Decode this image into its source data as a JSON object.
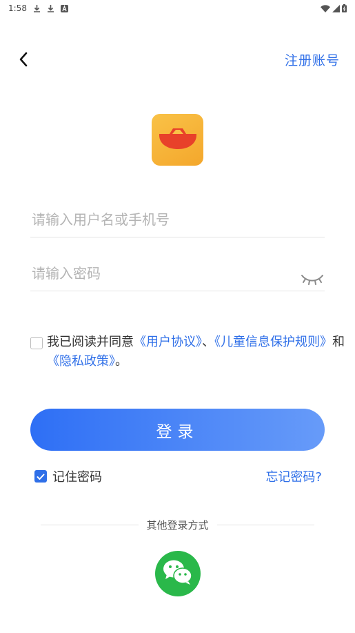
{
  "status_bar": {
    "time": "1:58",
    "icons": [
      "download-icon",
      "download-icon",
      "a-notification-icon",
      "wifi-icon",
      "signal-icon",
      "battery-icon"
    ]
  },
  "nav": {
    "back_icon": "chevron-left-icon",
    "register_label": "注册账号"
  },
  "logo": {
    "icon": "boat-icon",
    "colors": {
      "bg_top": "#f9c247",
      "bg_bottom": "#f4a72c",
      "boat": "#e8412a"
    }
  },
  "form": {
    "username": {
      "value": "",
      "placeholder": "请输入用户名或手机号"
    },
    "password": {
      "value": "",
      "placeholder": "请输入密码",
      "toggle_icon": "eye-closed-icon"
    }
  },
  "agreement": {
    "checked": false,
    "prefix": "我已阅读并同意",
    "user_agreement": "《用户协议》",
    "sep": "、",
    "child_privacy": "《儿童信息保护规则》",
    "and": "和",
    "privacy_policy": "《隐私政策》",
    "end": "。"
  },
  "login_button": {
    "label": "登录"
  },
  "remember": {
    "checked": true,
    "label": "记住密码"
  },
  "forgot": {
    "label": "忘记密码?"
  },
  "other_login": {
    "label": "其他登录方式",
    "wechat_icon": "wechat-icon"
  },
  "colors": {
    "accent": "#2f6fe8",
    "button_gradient_start": "#2e6ff5",
    "button_gradient_end": "#679bf9",
    "wechat_green": "#2ab84a"
  }
}
